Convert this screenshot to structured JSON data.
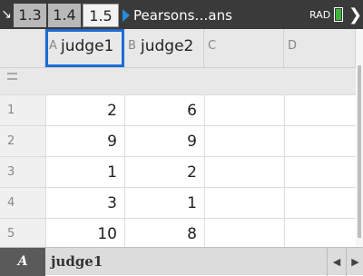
{
  "toolbar": {
    "corner_icon": "↘",
    "tabs": [
      "1.3",
      "1.4",
      "1.5"
    ],
    "active_tab": "1.5",
    "document_name": "Pearsons…ans",
    "mode": "RAD",
    "close_glyph": "❯"
  },
  "columns": [
    {
      "letter": "A",
      "name": "judge1"
    },
    {
      "letter": "B",
      "name": "judge2"
    },
    {
      "letter": "C",
      "name": ""
    },
    {
      "letter": "D",
      "name": ""
    }
  ],
  "rows": [
    {
      "num": "1",
      "a": "2",
      "b": "6"
    },
    {
      "num": "2",
      "a": "9",
      "b": "9"
    },
    {
      "num": "3",
      "a": "1",
      "b": "2"
    },
    {
      "num": "4",
      "a": "3",
      "b": "1"
    },
    {
      "num": "5",
      "a": "10",
      "b": "8"
    }
  ],
  "status": {
    "cell_ref": "A",
    "cell_content": "judge1",
    "nav_left": "◀",
    "nav_right": "▶"
  },
  "colors": {
    "accent": "#1d6bd6",
    "tab_arrow": "#2a8ad8",
    "battery": "#3db53d"
  }
}
